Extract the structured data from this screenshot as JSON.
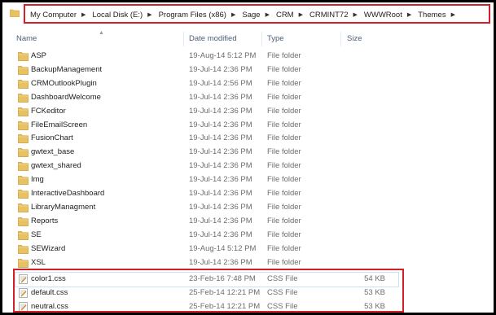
{
  "breadcrumb": [
    "My Computer",
    "Local Disk (E:)",
    "Program Files (x86)",
    "Sage",
    "CRM",
    "CRMINT72",
    "WWWRoot",
    "Themes"
  ],
  "columns": {
    "name": "Name",
    "date": "Date modified",
    "type": "Type",
    "size": "Size"
  },
  "folders": [
    {
      "name": "ASP",
      "date": "19-Aug-14 5:12 PM",
      "type": "File folder",
      "size": ""
    },
    {
      "name": "BackupManagement",
      "date": "19-Jul-14 2:36 PM",
      "type": "File folder",
      "size": ""
    },
    {
      "name": "CRMOutlookPlugin",
      "date": "19-Jul-14 2:56 PM",
      "type": "File folder",
      "size": ""
    },
    {
      "name": "DashboardWelcome",
      "date": "19-Jul-14 2:36 PM",
      "type": "File folder",
      "size": ""
    },
    {
      "name": "FCKeditor",
      "date": "19-Jul-14 2:36 PM",
      "type": "File folder",
      "size": ""
    },
    {
      "name": "FileEmailScreen",
      "date": "19-Jul-14 2:36 PM",
      "type": "File folder",
      "size": ""
    },
    {
      "name": "FusionChart",
      "date": "19-Jul-14 2:36 PM",
      "type": "File folder",
      "size": ""
    },
    {
      "name": "gwtext_base",
      "date": "19-Jul-14 2:36 PM",
      "type": "File folder",
      "size": ""
    },
    {
      "name": "gwtext_shared",
      "date": "19-Jul-14 2:36 PM",
      "type": "File folder",
      "size": ""
    },
    {
      "name": "Img",
      "date": "19-Jul-14 2:36 PM",
      "type": "File folder",
      "size": ""
    },
    {
      "name": "InteractiveDashboard",
      "date": "19-Jul-14 2:36 PM",
      "type": "File folder",
      "size": ""
    },
    {
      "name": "LibraryManagment",
      "date": "19-Jul-14 2:36 PM",
      "type": "File folder",
      "size": ""
    },
    {
      "name": "Reports",
      "date": "19-Jul-14 2:36 PM",
      "type": "File folder",
      "size": ""
    },
    {
      "name": "SE",
      "date": "19-Jul-14 2:36 PM",
      "type": "File folder",
      "size": ""
    },
    {
      "name": "SEWizard",
      "date": "19-Aug-14 5:12 PM",
      "type": "File folder",
      "size": ""
    },
    {
      "name": "XSL",
      "date": "19-Jul-14 2:36 PM",
      "type": "File folder",
      "size": ""
    }
  ],
  "files": [
    {
      "name": "color1.css",
      "date": "23-Feb-16 7:48 PM",
      "type": "CSS File",
      "size": "54 KB"
    },
    {
      "name": "default.css",
      "date": "25-Feb-14 12:21 PM",
      "type": "CSS File",
      "size": "53 KB"
    },
    {
      "name": "neutral.css",
      "date": "25-Feb-14 12:21 PM",
      "type": "CSS File",
      "size": "53 KB"
    }
  ],
  "colors": {
    "highlight": "#d21f2a",
    "folder": "#e8c262",
    "header_text": "#4c607a"
  }
}
